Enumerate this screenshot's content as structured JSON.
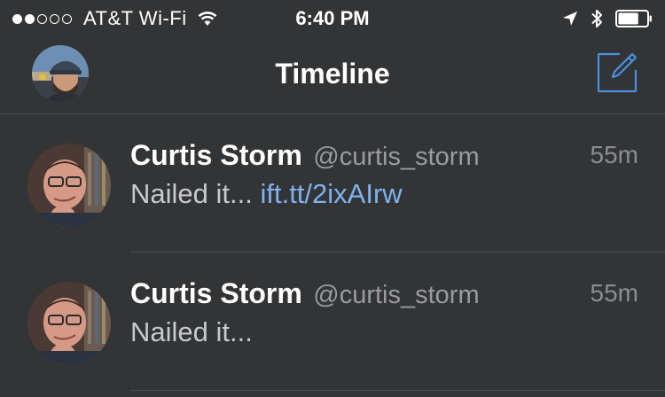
{
  "status_bar": {
    "signal": {
      "filled": 2,
      "total": 5
    },
    "carrier": "AT&T Wi-Fi",
    "time": "6:40 PM",
    "icons": [
      "wifi-icon",
      "location-arrow-icon",
      "bluetooth-icon",
      "battery-icon"
    ],
    "battery_level": 0.72
  },
  "nav": {
    "title": "Timeline",
    "profile_avatar_icon": "profile-avatar",
    "compose_icon": "compose-icon",
    "accent_color": "#4a90e2"
  },
  "tweets": [
    {
      "name": "Curtis Storm",
      "handle": "@curtis_storm",
      "time": "55m",
      "text": "Nailed it...",
      "link": "ift.tt/2ixAIrw"
    },
    {
      "name": "Curtis Storm",
      "handle": "@curtis_storm",
      "time": "55m",
      "text": "Nailed it...",
      "link": ""
    }
  ],
  "colors": {
    "background": "#333435",
    "link": "#7fb2ee",
    "separator": "#4a4b4c"
  }
}
